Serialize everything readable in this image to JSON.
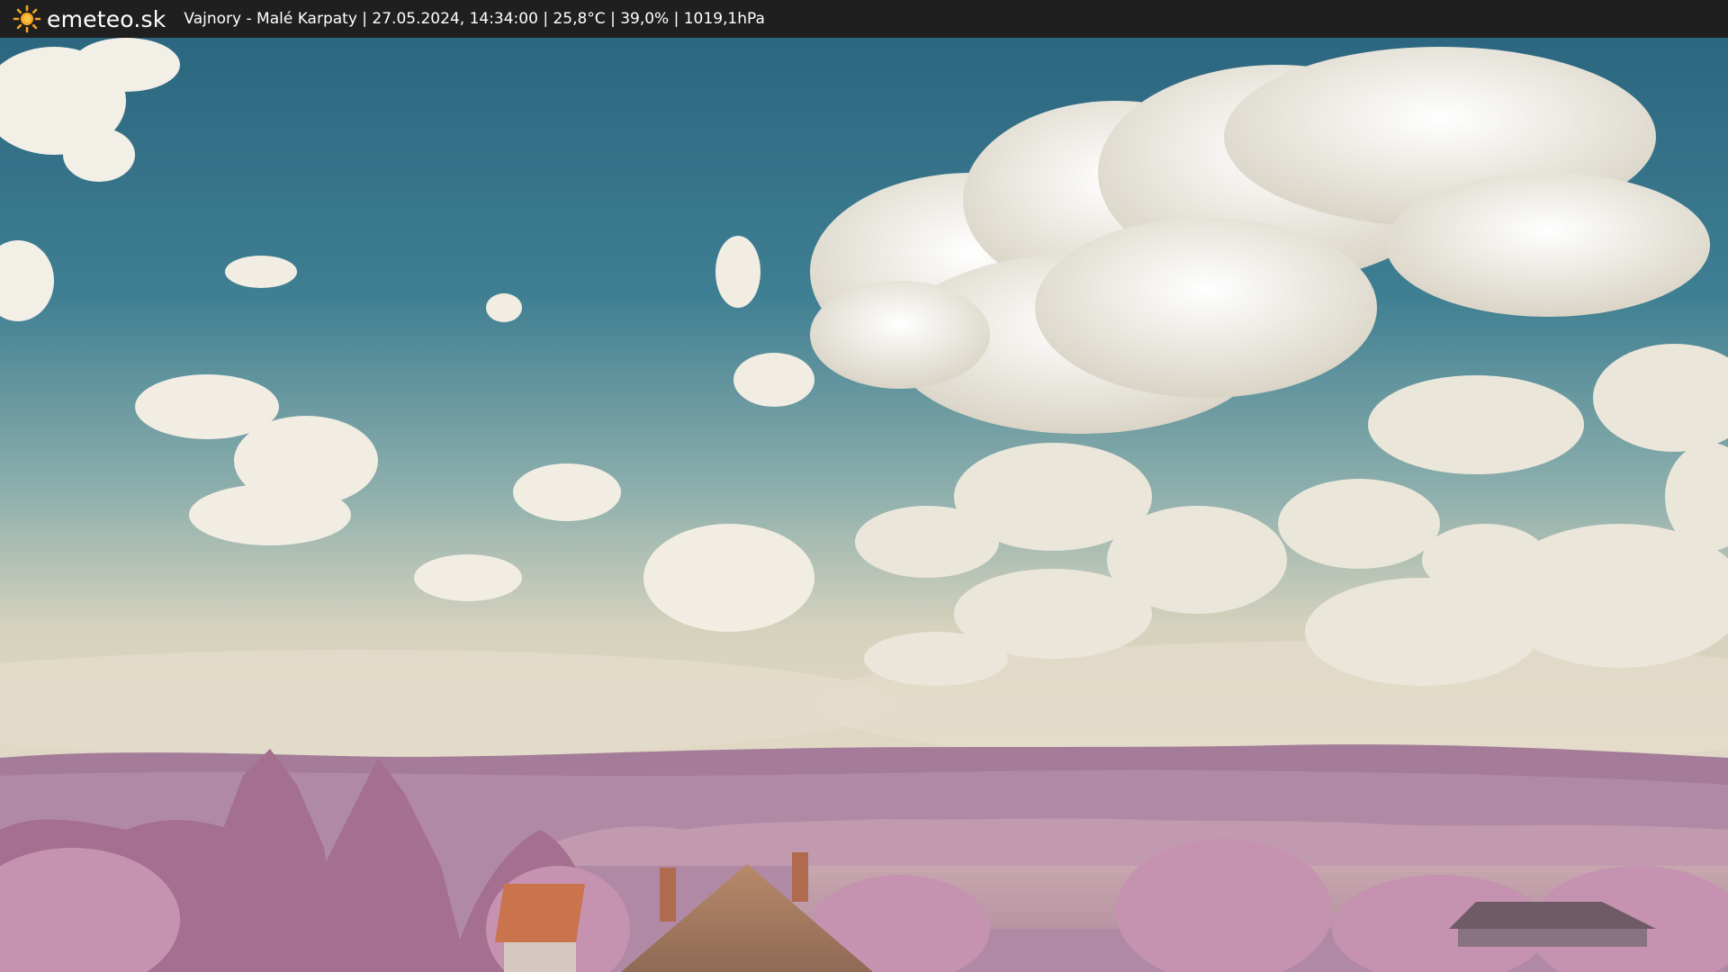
{
  "header": {
    "site_name": "emeteo.sk",
    "caption": "Vajnory - Malé Karpaty | 27.05.2024, 14:34:00 | 25,8°C | 39,0% | 1019,1hPa",
    "logo_icon": "sun-icon"
  },
  "colors": {
    "bar_background": "#1f1f1f",
    "sun": "#f6a623",
    "sky_top": "#2e6a82",
    "sky_bottom": "#d7d2bf",
    "hills": "#a07a97",
    "foliage": "#b98aa6",
    "roof": "#c97a55"
  },
  "webcam": {
    "image_icon": "webcam-landscape-image"
  }
}
